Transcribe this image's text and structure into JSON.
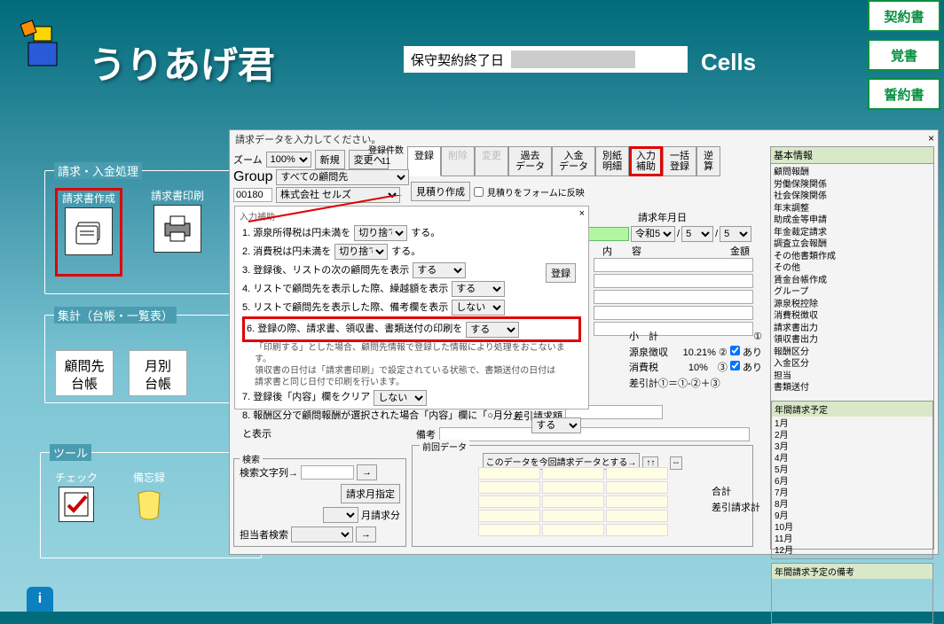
{
  "app": {
    "title": "うりあげ君",
    "contract_label": "保守契約終了日",
    "cells_label": "Cells"
  },
  "side_buttons": [
    "契約書",
    "覚書",
    "誓約書"
  ],
  "panels": {
    "p1": "請求・入金処理",
    "p2": "集計（台帳・一覧表）",
    "p3": "ツール",
    "invoice_create": "請求書作成",
    "invoice_print": "請求書印刷",
    "ledger1": "顧問先\n台帳",
    "ledger2": "月別\n台帳",
    "tool1": "チェック",
    "tool2": "備忘録"
  },
  "modal": {
    "header": "請求データを入力してください。",
    "zoom_label": "ズーム",
    "zoom": "100%",
    "new": "新規",
    "change": "変更へ",
    "reg_count_lbl": "登録件数",
    "reg_count": "11",
    "group_lbl": "Group",
    "group_val": "すべての顧問先",
    "code": "00180",
    "company": "株式会社 セルズ",
    "mitsumori_btn": "見積り作成",
    "mitsumori_chk": "見積りをフォームに反映",
    "tabs": [
      "登録",
      "削除",
      "変更",
      "過去\nデータ",
      "入金\nデータ",
      "別紙\n明細",
      "入力\n補助",
      "一括\n登録",
      "逆\n算"
    ],
    "date_lbl": "請求年月日",
    "era": "令和5",
    "month": "5",
    "day": "5",
    "col_content": "内　　容",
    "col_amount": "金額",
    "subtotal": "小　計",
    "gensen": "源泉徴収",
    "gensen_pct": "10.21%",
    "gensen_ari": "あり",
    "shouhi": "消費税",
    "shouhi_pct": "10%",
    "shouhi_ari": "あり",
    "sashihiki": "差引計①＝①-②＋③",
    "sashihiki_req": "差引請求額",
    "biko": "備考",
    "sub": {
      "title": "入力補助",
      "i1": "1.  源泉所得税は円未満を",
      "v1": "切り捨て",
      "suru": "する。",
      "i2": "2.  消費税は円未満を",
      "v2": "切り捨て",
      "i3": "3.  登録後、リストの次の顧問先を表示",
      "v3": "する",
      "i4": "4.  リストで顧問先を表示した際、繰越額を表示",
      "v4": "する",
      "i5": "5.  リストで顧問先を表示した際、備考欄を表示",
      "v5": "しない",
      "i6": "6.  登録の際、請求書、領収書、書類送付の印刷を",
      "v6": "する",
      "note6": "「印刷する」とした場合、顧問先情報で登録した情報により処理をおこないます。\n領収書の日付は「請求書印刷」で設定されている状態で、書類送付の日付は\n請求書と同じ日付で印刷を行います。",
      "i7": "7.  登録後「内容」欄をクリア",
      "v7": "しない",
      "i8": "8.  報酬区分で顧問報酬が選択された場合「内容」欄に「○月分」と表示",
      "v8": "する",
      "reg_btn": "登録"
    },
    "prev": {
      "title": "前回データ",
      "copy_btn": "このデータを今回請求データとする→",
      "arrow": "↑↑",
      "dash": "--"
    },
    "search": {
      "title": "検索",
      "kw": "検索文字列→",
      "arrow": "→",
      "month_btn": "請求月指定",
      "month_chk": "月請求分",
      "tantou": "担当者検索"
    },
    "basic": {
      "title": "基本情報",
      "items": [
        "顧問報酬",
        "労働保険関係",
        "社会保険関係",
        "年末調整",
        "助成金等申請",
        "年金裁定請求",
        "調査立会報酬",
        "その他書類作成",
        "その他",
        "賃金台帳作成",
        "グループ",
        "源泉税控除",
        "消費税徴収",
        "",
        "請求書出力",
        "領収書出力",
        "報酬区分",
        "入金区分",
        "担当",
        "書類送付"
      ],
      "nen_title": "年間請求予定",
      "months": [
        "1月",
        "2月",
        "3月",
        "4月",
        "5月",
        "6月",
        "7月",
        "8月",
        "9月",
        "10月",
        "11月",
        "12月"
      ],
      "nen_biko": "年間請求予定の備考"
    },
    "sums": {
      "goukei": "合計",
      "sashihiki": "差引請求計"
    }
  }
}
